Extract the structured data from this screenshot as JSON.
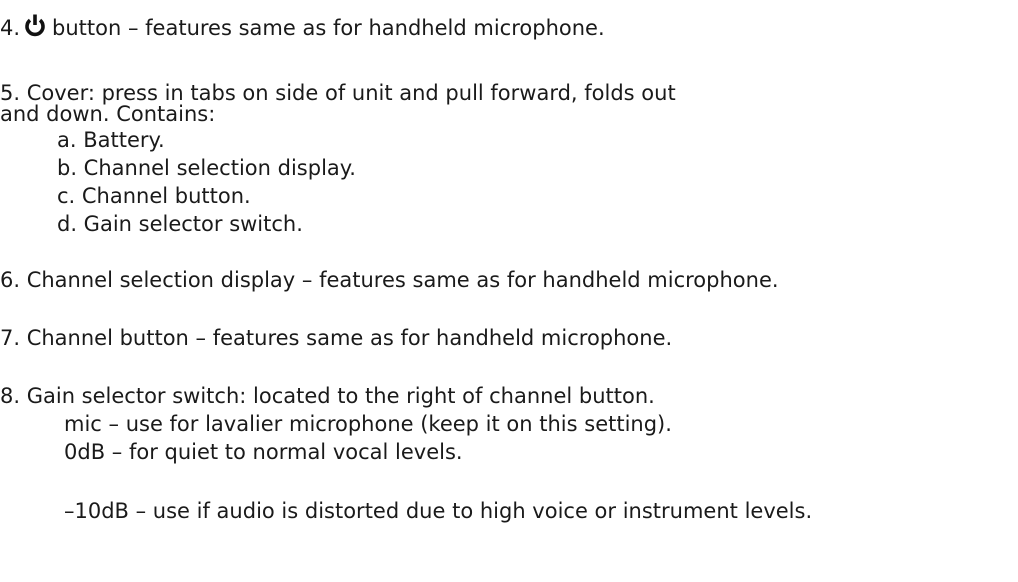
{
  "item4": {
    "number": "4.",
    "icon": "power-icon",
    "text": "button – features same as for handheld microphone."
  },
  "item5": {
    "line1": "5. Cover: press in tabs on side of unit and pull forward, folds out",
    "line2": "and down. Contains:",
    "subitems": [
      "a. Battery.",
      "b. Channel selection display.",
      "c. Channel button.",
      "d. Gain selector switch."
    ]
  },
  "item6": {
    "text": "6. Channel selection display – features same as for handheld microphone."
  },
  "item7": {
    "text": "7. Channel button – features same as for handheld microphone."
  },
  "item8": {
    "text": "8. Gain selector switch: located to the right of channel button.",
    "options": [
      "mic – use for lavalier microphone (keep it on this setting).",
      "0dB – for quiet to normal vocal levels.",
      "–10dB – use if audio is distorted due to high voice or instrument levels."
    ]
  }
}
